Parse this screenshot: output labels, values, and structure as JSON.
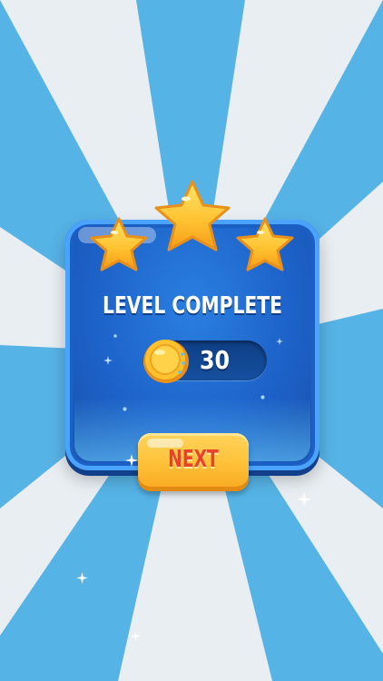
{
  "dialog": {
    "title": "LEVEL COMPLETE",
    "stars_earned": 3,
    "stars_total": 3
  },
  "reward": {
    "value": "30",
    "icon": "gold-coin-icon"
  },
  "next_button": {
    "label": "NEXT"
  },
  "colors": {
    "background_light": "#e8eef2",
    "background_blue": "#56b3e6",
    "panel": "#1d62c9",
    "star": "#ffc12e",
    "button": "#ffc23a",
    "button_text": "#e8432a"
  }
}
